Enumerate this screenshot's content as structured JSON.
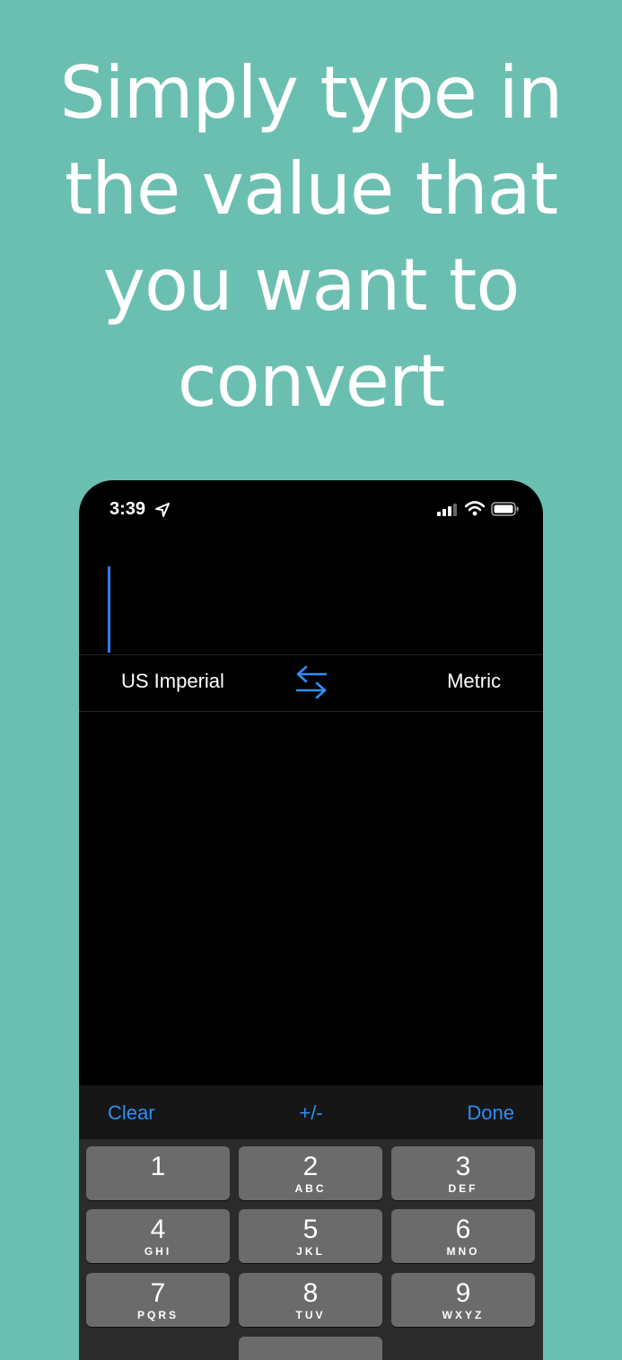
{
  "promo": {
    "headline_lines": [
      "Simply type in",
      "the value that",
      "you want to",
      "convert"
    ]
  },
  "status_bar": {
    "time": "3:39",
    "icons": [
      "location-arrow-icon",
      "cellular-signal-icon",
      "wifi-icon",
      "battery-icon"
    ]
  },
  "input": {
    "value": ""
  },
  "units": {
    "from": "US Imperial",
    "to": "Metric",
    "swap_icon": "swap-arrows-icon"
  },
  "toolbar": {
    "clear_label": "Clear",
    "sign_label": "+/-",
    "done_label": "Done"
  },
  "keypad": {
    "keys": [
      {
        "num": "1",
        "letters": ""
      },
      {
        "num": "2",
        "letters": "ABC"
      },
      {
        "num": "3",
        "letters": "DEF"
      },
      {
        "num": "4",
        "letters": "GHI"
      },
      {
        "num": "5",
        "letters": "JKL"
      },
      {
        "num": "6",
        "letters": "MNO"
      },
      {
        "num": "7",
        "letters": "PQRS"
      },
      {
        "num": "8",
        "letters": "TUV"
      },
      {
        "num": "9",
        "letters": "WXYZ"
      }
    ]
  },
  "colors": {
    "background": "#6bbfb1",
    "accent": "#2f8ef6",
    "key": "#6b6b6b"
  }
}
